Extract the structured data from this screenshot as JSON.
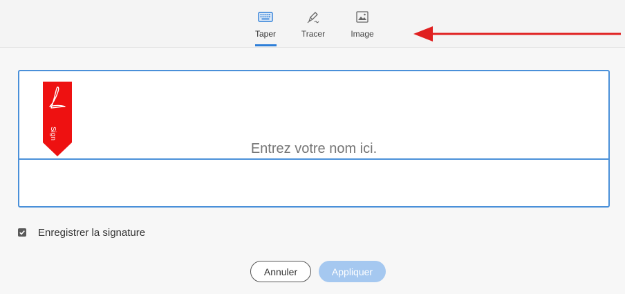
{
  "tabs": [
    {
      "label": "Taper",
      "icon": "keyboard-icon",
      "active": true
    },
    {
      "label": "Tracer",
      "icon": "pen-draw-icon",
      "active": false
    },
    {
      "label": "Image",
      "icon": "image-icon",
      "active": false
    }
  ],
  "signature": {
    "placeholder": "Entrez votre nom ici.",
    "badge_text": "Sign"
  },
  "save_signature": {
    "label": "Enregistrer la signature",
    "checked": true
  },
  "buttons": {
    "cancel": "Annuler",
    "apply": "Appliquer"
  },
  "colors": {
    "accent": "#4a90d9",
    "annotation": "#e02020",
    "badge": "#ee1111",
    "apply_disabled": "#a5c8f0"
  }
}
